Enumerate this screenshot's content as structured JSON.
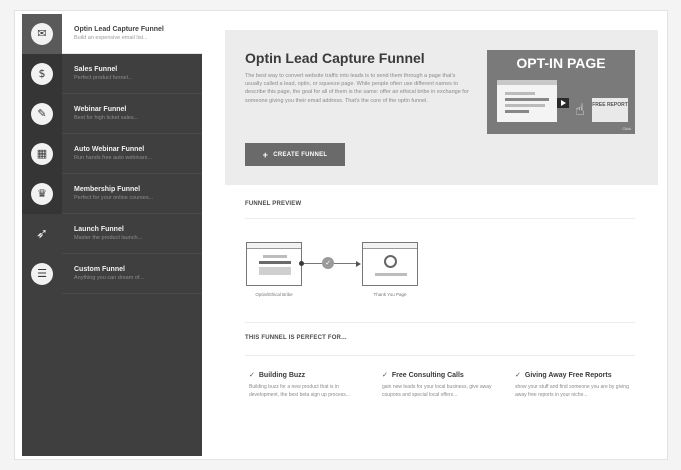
{
  "sidebar": {
    "items": [
      {
        "title": "Optin Lead Capture Funnel",
        "subtitle": "Build an expensive email list...",
        "icon": "envelope-icon",
        "glyph": "✉",
        "active": true
      },
      {
        "title": "Sales Funnel",
        "subtitle": "Perfect product funnel...",
        "icon": "dollar-icon",
        "glyph": "$",
        "active": false
      },
      {
        "title": "Webinar Funnel",
        "subtitle": "Best for high ticket sales...",
        "icon": "ticket-icon",
        "glyph": "✎",
        "active": false
      },
      {
        "title": "Auto Webinar Funnel",
        "subtitle": "Run hands free auto webinars...",
        "icon": "calendar-icon",
        "glyph": "▦",
        "active": false
      },
      {
        "title": "Membership Funnel",
        "subtitle": "Perfect for your online courses...",
        "icon": "trophy-icon",
        "glyph": "♛",
        "active": false
      },
      {
        "title": "Launch Funnel",
        "subtitle": "Master the product launch...",
        "icon": "rocket-icon",
        "glyph": "➶",
        "active": false
      },
      {
        "title": "Custom Funnel",
        "subtitle": "Anything you can dream of...",
        "icon": "list-icon",
        "glyph": "☰",
        "active": false
      }
    ]
  },
  "hero": {
    "title": "Optin Lead Capture Funnel",
    "description": "The best way to convert website traffic into leads is to send them through a page that's usually called a lead, optin, or squeeze page. While people often use different names to describe this page, the goal for all of them is the same: offer an ethical bribe in exchange for someone giving you their email address. That's the core of the optin funnel.",
    "button_label": "CREATE FUNNEL",
    "button_icon": "+",
    "image_title": "OPT-IN PAGE",
    "image_card_text": "FREE REPORT",
    "image_corner": "Click"
  },
  "preview": {
    "label": "FUNNEL PREVIEW",
    "steps": [
      {
        "label": "Optin/Ethical Bribe"
      },
      {
        "label": "Thank You Page"
      }
    ]
  },
  "perfect": {
    "label": "THIS FUNNEL IS PERFECT FOR...",
    "items": [
      {
        "title": "Building Buzz",
        "desc": "Building buzz for a new product that is in development, the best beta sign up process..."
      },
      {
        "title": "Free Consulting Calls",
        "desc": "gain new leads for your local business, give away coupons and special local offers..."
      },
      {
        "title": "Giving Away Free Reports",
        "desc": "show your stuff and find someone you are by giving away free reports in your niche..."
      }
    ]
  }
}
